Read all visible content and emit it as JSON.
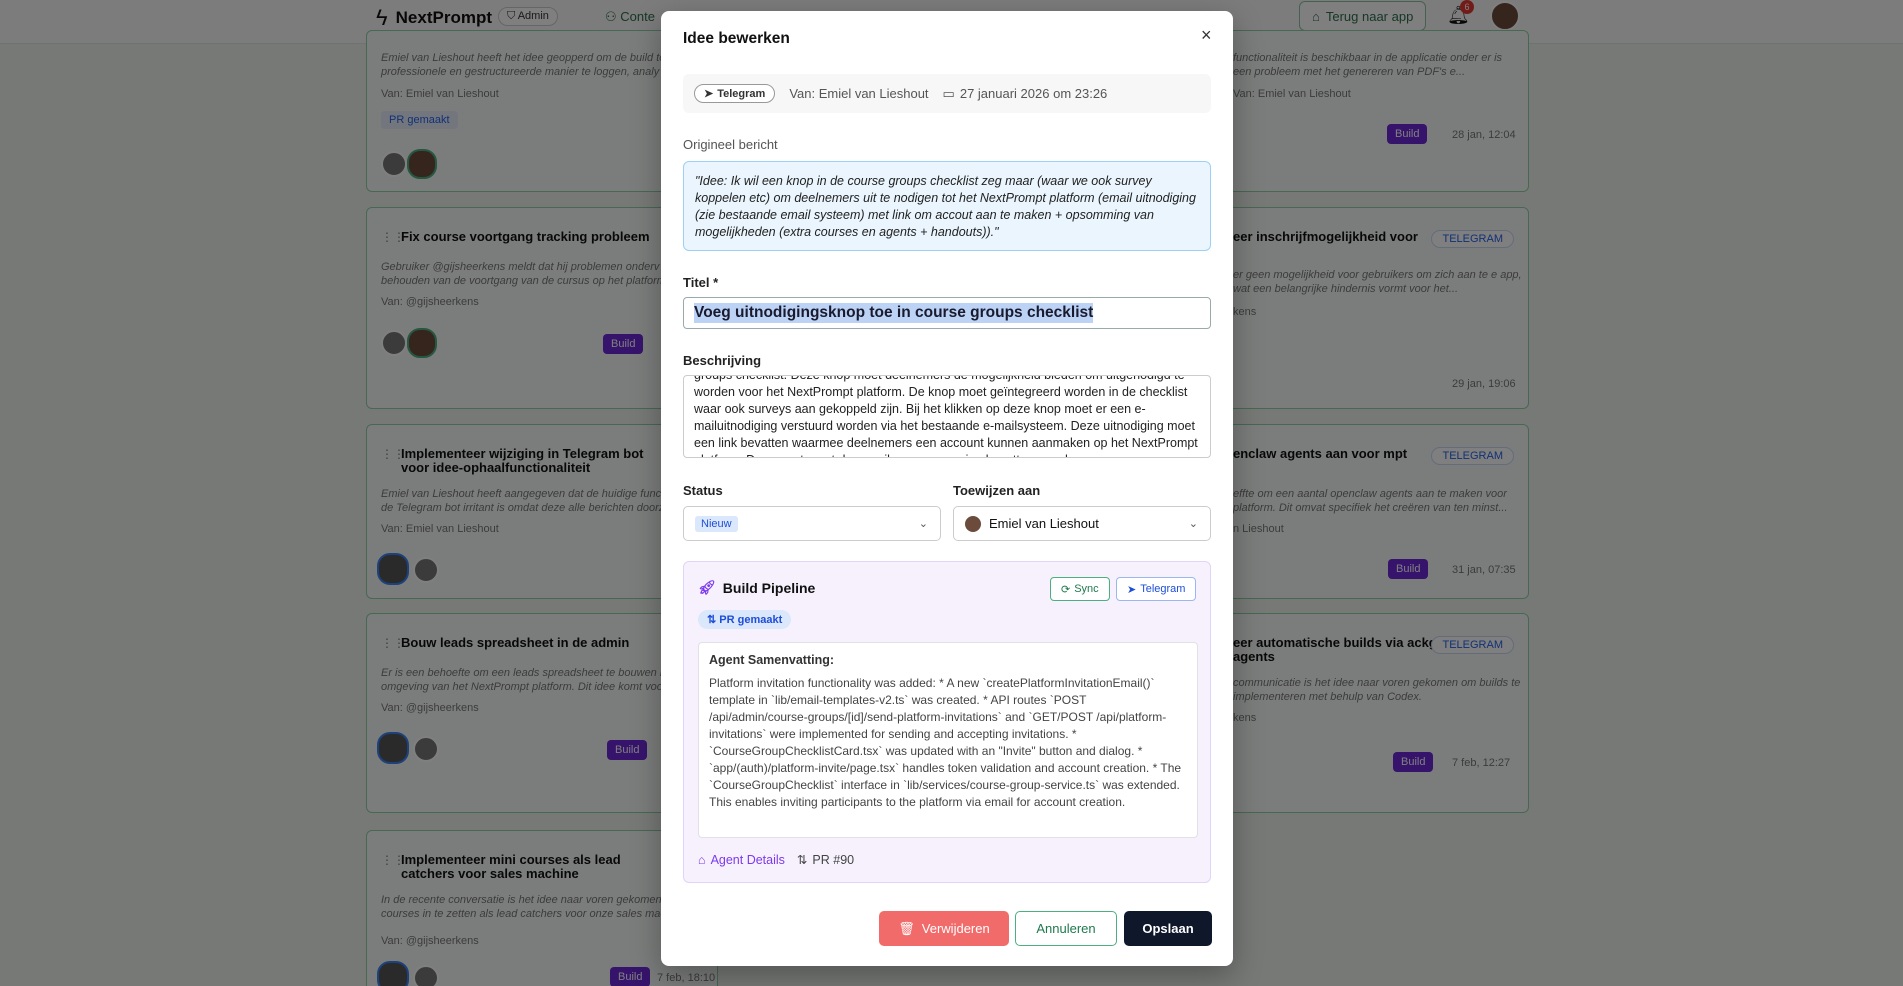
{
  "app": {
    "logo_text": "NextPrompt",
    "admin_label": "Admin",
    "nav_content": "Conte",
    "back_button": "Terug naar app",
    "notification_count": "6"
  },
  "background_cards": [
    {
      "title": "",
      "desc": "Emiel van Lieshout heeft het idee geopperd om de build to professionele en gestructureerde manier te loggen, analy",
      "from": "Van: Emiel van Lieshout",
      "pr": "PR gemaakt"
    },
    {
      "title": "",
      "desc": "functionaliteit is beschikbaar in de applicatie onder er is een probleem met het genereren van PDF's e...",
      "from": "Van: Emiel van Lieshout",
      "build": "Build",
      "date": "28 jan, 12:04"
    },
    {
      "title": "Fix course voortgang tracking probleem",
      "desc": "Gebruiker @gijsheerkens meldt dat hij problemen onderv behouden van de voortgang van de cursus op het platform",
      "from": "Van: @gijsheerkens",
      "build": "Build"
    },
    {
      "title": "eer inschrijfmogelijkheid voor",
      "desc": "er geen mogelijkheid voor gebruikers om zich aan te e app, wat een belangrijke hindernis vormt voor het...",
      "from": "kens",
      "tag": "TELEGRAM",
      "date": "29 jan, 19:06"
    },
    {
      "title": "Implementeer wijziging in Telegram bot voor idee-ophaalfunctionaliteit",
      "desc": "Emiel van Lieshout heeft aangegeven dat de huidige funct de Telegram bot irritant is omdat deze alle berichten doorz",
      "from": "Van: Emiel van Lieshout"
    },
    {
      "title": "enclaw agents aan voor mpt",
      "desc": "effte om een aantal openclaw agents aan te maken voor platform. Dit omvat specifiek het creëren van ten minst...",
      "from": "n Lieshout",
      "tag": "TELEGRAM",
      "build": "Build",
      "date": "31 jan, 07:35"
    },
    {
      "title": "Bouw leads spreadsheet in de admin",
      "desc": "Er is een behoefte om een leads spreadsheet te bouwen in omgeving van het NextPrompt platform. Dit idee komt voo",
      "from": "Van: @gijsheerkens",
      "build": "Build"
    },
    {
      "title": "eer automatische builds via ackground agents",
      "desc": "communicatie is het idee naar voren gekomen om builds te implementeren met behulp van Codex.",
      "from": "kens",
      "tag": "TELEGRAM",
      "build": "Build",
      "date": "7 feb, 12:27"
    },
    {
      "title": "Implementeer mini courses als lead catchers voor sales machine",
      "desc": "In de recente conversatie is het idee naar voren gekomen courses in te zetten als lead catchers voor onze sales mac",
      "from": "Van: @gijsheerkens",
      "build": "Build",
      "date": "7 feb, 18:10"
    }
  ],
  "modal": {
    "title": "Idee bewerken",
    "close_label": "×",
    "source_badge": "Telegram",
    "from": "Van: Emiel van Lieshout",
    "date": "27 januari 2026 om 23:26",
    "original_label": "Origineel bericht",
    "original_message": "\"Idee: Ik wil een knop in de course groups checklist zeg maar (waar we ook survey koppelen etc) om deelnemers uit te nodigen tot het NextPrompt platform (email uitnodiging (zie bestaande email systeem) met link om accout aan te maken + opsomming van mogelijkheden (extra courses en agents + handouts)).\"",
    "title_label": "Titel *",
    "title_value": "Voeg uitnodigingsknop toe in course groups checklist",
    "description_label": "Beschrijving",
    "description_value": "groups checklist. Deze knop moet deelnemers de mogelijkheid bieden om uitgenodigd te worden voor het NextPrompt platform. De knop moet geïntegreerd worden in de checklist waar ook surveys aan gekoppeld zijn. Bij het klikken op deze knop moet er een e-mailuitnodiging verstuurd worden via het bestaande e-mailsysteem. Deze uitnodiging moet een link bevatten waarmee deelnemers een account kunnen aanmaken op het NextPrompt platform. Daarnaast moet de e-mail een opsomming bevatten van de",
    "status_label": "Status",
    "status_value": "Nieuw",
    "assign_label": "Toewijzen aan",
    "assign_value": "Emiel van Lieshout",
    "pipeline": {
      "title": "Build Pipeline",
      "sync_button": "Sync",
      "telegram_button": "Telegram",
      "pr_badge": "PR gemaakt",
      "summary_heading": "Agent Samenvatting:",
      "summary_body": "Platform invitation functionality was added: * A new `createPlatformInvitationEmail()` template in `lib/email-templates-v2.ts` was created. * API routes `POST /api/admin/course-groups/[id]/send-platform-invitations` and `GET/POST /api/platform-invitations` were implemented for sending and accepting invitations. * `CourseGroupChecklistCard.tsx` was updated with an \"Invite\" button and dialog. * `app/(auth)/platform-invite/page.tsx` handles token validation and account creation. * The `CourseGroupChecklist` interface in `lib/services/course-group-service.ts` was extended. This enables inviting participants to the platform via email for account creation.",
      "agent_details_link": "Agent Details",
      "pr_link": "PR #90"
    },
    "delete_button": "Verwijderen",
    "cancel_button": "Annuleren",
    "save_button": "Opslaan"
  },
  "colors": {
    "accent_purple": "#7c3aed",
    "accent_green": "#1e7a4f",
    "danger": "#f26b6b",
    "primary_dark": "#0f172a"
  }
}
